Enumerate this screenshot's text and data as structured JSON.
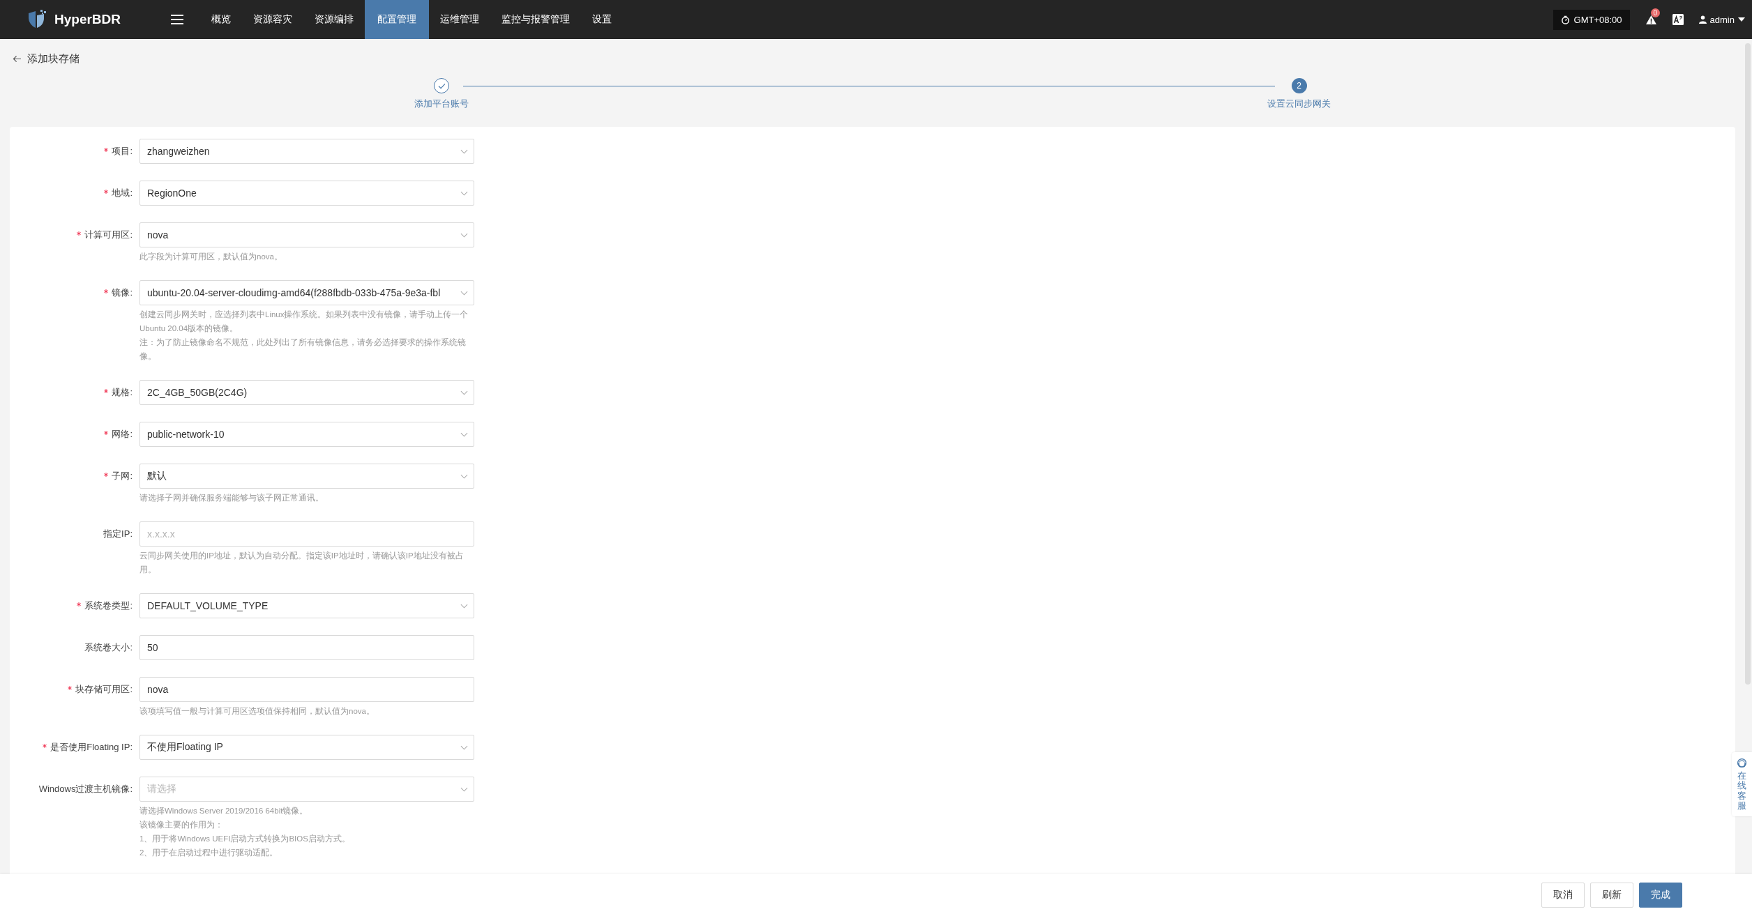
{
  "app": {
    "name": "HyperBDR"
  },
  "nav": [
    {
      "label": "概览",
      "selected": false
    },
    {
      "label": "资源容灾",
      "selected": false
    },
    {
      "label": "资源编排",
      "selected": false
    },
    {
      "label": "配置管理",
      "selected": true
    },
    {
      "label": "运维管理",
      "selected": false
    },
    {
      "label": "监控与报警管理",
      "selected": false
    },
    {
      "label": "设置",
      "selected": false
    }
  ],
  "header": {
    "timezone": "GMT+08:00",
    "alert_count": "0",
    "user": "admin"
  },
  "page": {
    "title": "添加块存储"
  },
  "steps": [
    {
      "label": "添加平台账号",
      "done": true
    },
    {
      "label": "设置云同步网关",
      "number": "2",
      "done": false
    }
  ],
  "fields": [
    {
      "label": "项目:",
      "required": true,
      "kind": "select",
      "value": "zhangweizhen"
    },
    {
      "label": "地域:",
      "required": true,
      "kind": "select",
      "value": "RegionOne"
    },
    {
      "label": "计算可用区:",
      "required": true,
      "kind": "select",
      "value": "nova",
      "help": [
        "此字段为计算可用区，默认值为nova。"
      ]
    },
    {
      "label": "镜像:",
      "required": true,
      "kind": "select",
      "value": "ubuntu-20.04-server-cloudimg-amd64(f288fbdb-033b-475a-9e3a-fbl",
      "help": [
        "创建云同步网关时，应选择列表中Linux操作系统。如果列表中没有镜像，请手动上传一个Ubuntu 20.04版本的镜像。",
        "注：为了防止镜像命名不规范，此处列出了所有镜像信息，请务必选择要求的操作系统镜像。"
      ]
    },
    {
      "label": "规格:",
      "required": true,
      "kind": "select",
      "value": "2C_4GB_50GB(2C4G)"
    },
    {
      "label": "网络:",
      "required": true,
      "kind": "select",
      "value": "public-network-10"
    },
    {
      "label": "子网:",
      "required": true,
      "kind": "select",
      "value": "默认",
      "help": [
        "请选择子网并确保服务端能够与该子网正常通讯。"
      ]
    },
    {
      "label": "指定IP:",
      "required": false,
      "kind": "input",
      "placeholder": "x.x.x.x",
      "help": [
        "云同步网关使用的IP地址，默认为自动分配。指定该IP地址时，请确认该IP地址没有被占用。"
      ]
    },
    {
      "label": "系统卷类型:",
      "required": true,
      "kind": "select",
      "value": "DEFAULT_VOLUME_TYPE"
    },
    {
      "label": "系统卷大小:",
      "required": false,
      "kind": "input",
      "value": "50"
    },
    {
      "label": "块存储可用区:",
      "required": true,
      "kind": "input",
      "value": "nova",
      "help": [
        "该项填写值一般与计算可用区选项值保持相同，默认值为nova。"
      ]
    },
    {
      "label": "是否使用Floating IP:",
      "required": true,
      "kind": "select",
      "value": "不使用Floating IP"
    },
    {
      "label": "Windows过渡主机镜像:",
      "required": false,
      "kind": "select",
      "placeholder": "请选择",
      "help": [
        "请选择Windows Server 2019/2016 64bit镜像。",
        "该镜像主要的作用为：",
        "1、用于将Windows UEFI启动方式转换为BIOS启动方式。",
        "2、用于在启动过程中进行驱动适配。"
      ]
    }
  ],
  "footer_buttons": [
    {
      "label": "取消",
      "kind": "default"
    },
    {
      "label": "刷新",
      "kind": "default"
    },
    {
      "label": "完成",
      "kind": "primary"
    }
  ],
  "support": {
    "label": "在线客服"
  }
}
